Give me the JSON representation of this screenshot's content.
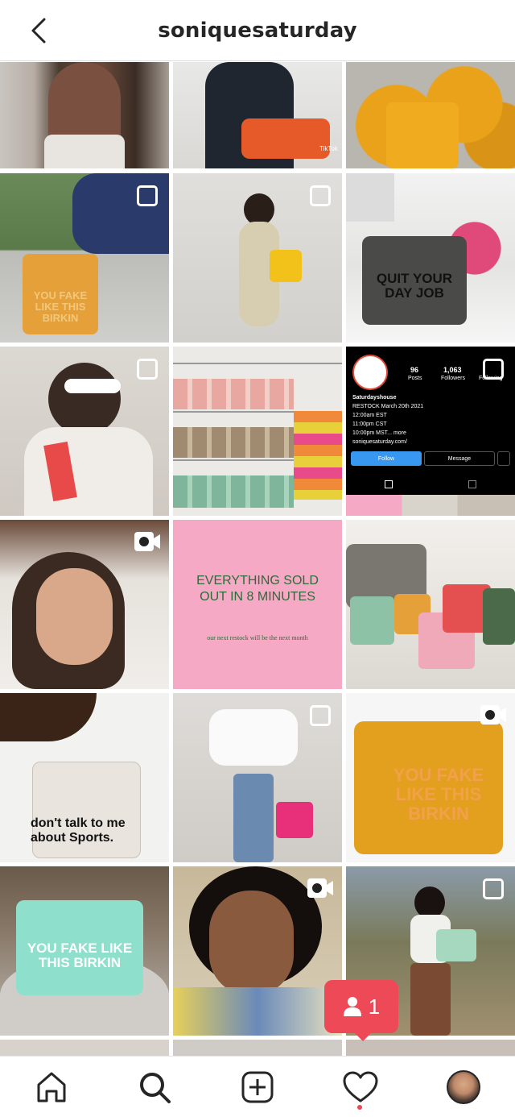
{
  "header": {
    "title": "soniquesaturday"
  },
  "tiles": {
    "r1c2": {
      "watermark": "TikTok"
    },
    "r2c1": {
      "bag_text": "YOU FAKE LIKE THIS BIRKIN"
    },
    "r2c3": {
      "bag_text": "QUIT YOUR DAY JOB"
    },
    "r3c3": {
      "posts_count": "96",
      "posts_label": "Posts",
      "followers_count": "1,063",
      "followers_label": "Followers",
      "following_label": "Following",
      "name": "Saturdayshouse",
      "bio1": "RESTOCK March 20th 2021",
      "bio2": "12:00am EST",
      "bio3": "11:00pm CST",
      "bio4": "10:00pm MST... more",
      "link": "soniquesaturday.com/",
      "follow_label": "Follow",
      "message_label": "Message"
    },
    "r4c2": {
      "headline": "EVERYTHING SOLD OUT IN 8 MINUTES",
      "subline": "our next restock will be the next month"
    },
    "r5c1": {
      "bag_text": "don't talk to me about Sports."
    },
    "r5c3": {
      "bag_text": "YOU FAKE LIKE THIS BIRKIN"
    },
    "r6c1": {
      "bag_text": "YOU FAKE LIKE THIS BIRKIN"
    }
  },
  "notification": {
    "count": "1"
  },
  "colors": {
    "notif": "#ed4956",
    "follow": "#3897f0",
    "pink_tile": "#f5a9c4",
    "green_text": "#2e6b3a"
  }
}
